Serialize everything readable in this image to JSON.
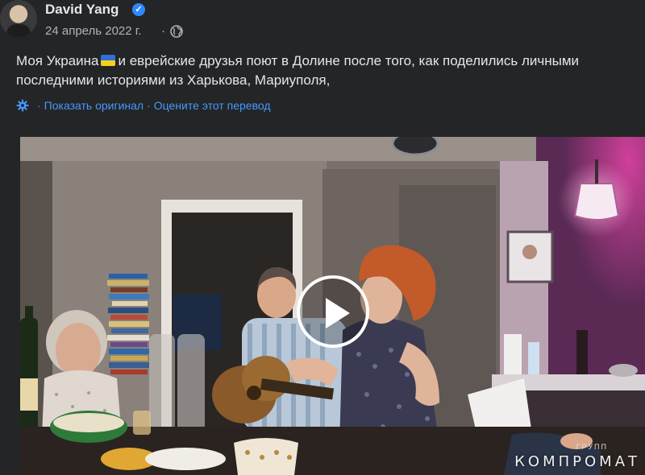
{
  "post": {
    "author": "David Yang",
    "date": "24 апрель 2022 г.",
    "separator": "·",
    "text_part1": "Моя Украина",
    "text_part2": "и еврейские друзья поют в Долине после того, как поделились личными последними историями из Харькова, Мариуполя,"
  },
  "translation": {
    "show_original": "Показать оригинал",
    "separator": "·",
    "rate": "Оцените этот перевод"
  },
  "video": {
    "watermark_small": "ГРУПП",
    "watermark": "КОМПРОМАТ"
  },
  "icons": {
    "verified": "verified-badge-icon",
    "privacy": "globe-icon",
    "translate": "gear-icon",
    "play": "play-icon",
    "flag": "ukraine-flag-emoji"
  },
  "colors": {
    "background": "#242526",
    "text": "#e4e6eb",
    "secondary_text": "#b0b3b8",
    "link": "#4599ff",
    "verified": "#2d88ff"
  }
}
